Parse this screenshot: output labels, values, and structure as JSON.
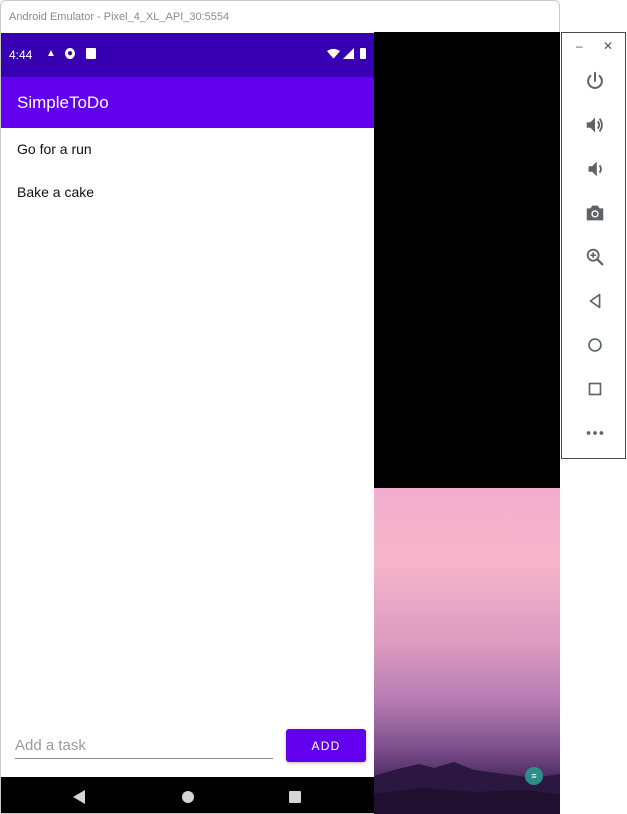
{
  "window": {
    "title": "Android Emulator - Pixel_4_XL_API_30:5554"
  },
  "statusbar": {
    "time": "4:44"
  },
  "app": {
    "title": "SimpleToDo",
    "tasks": [
      "Go for a run",
      "Bake a cake"
    ],
    "input": {
      "placeholder": "Add a task",
      "value": ""
    },
    "add_label": "ADD"
  },
  "colors": {
    "primary": "#6200ee",
    "primary_dark": "#3700b3"
  },
  "toolbar": {
    "buttons": [
      "power-icon",
      "volume-up-icon",
      "volume-down-icon",
      "camera-icon",
      "zoom-icon",
      "back-icon",
      "home-icon",
      "overview-icon",
      "more-icon"
    ]
  }
}
